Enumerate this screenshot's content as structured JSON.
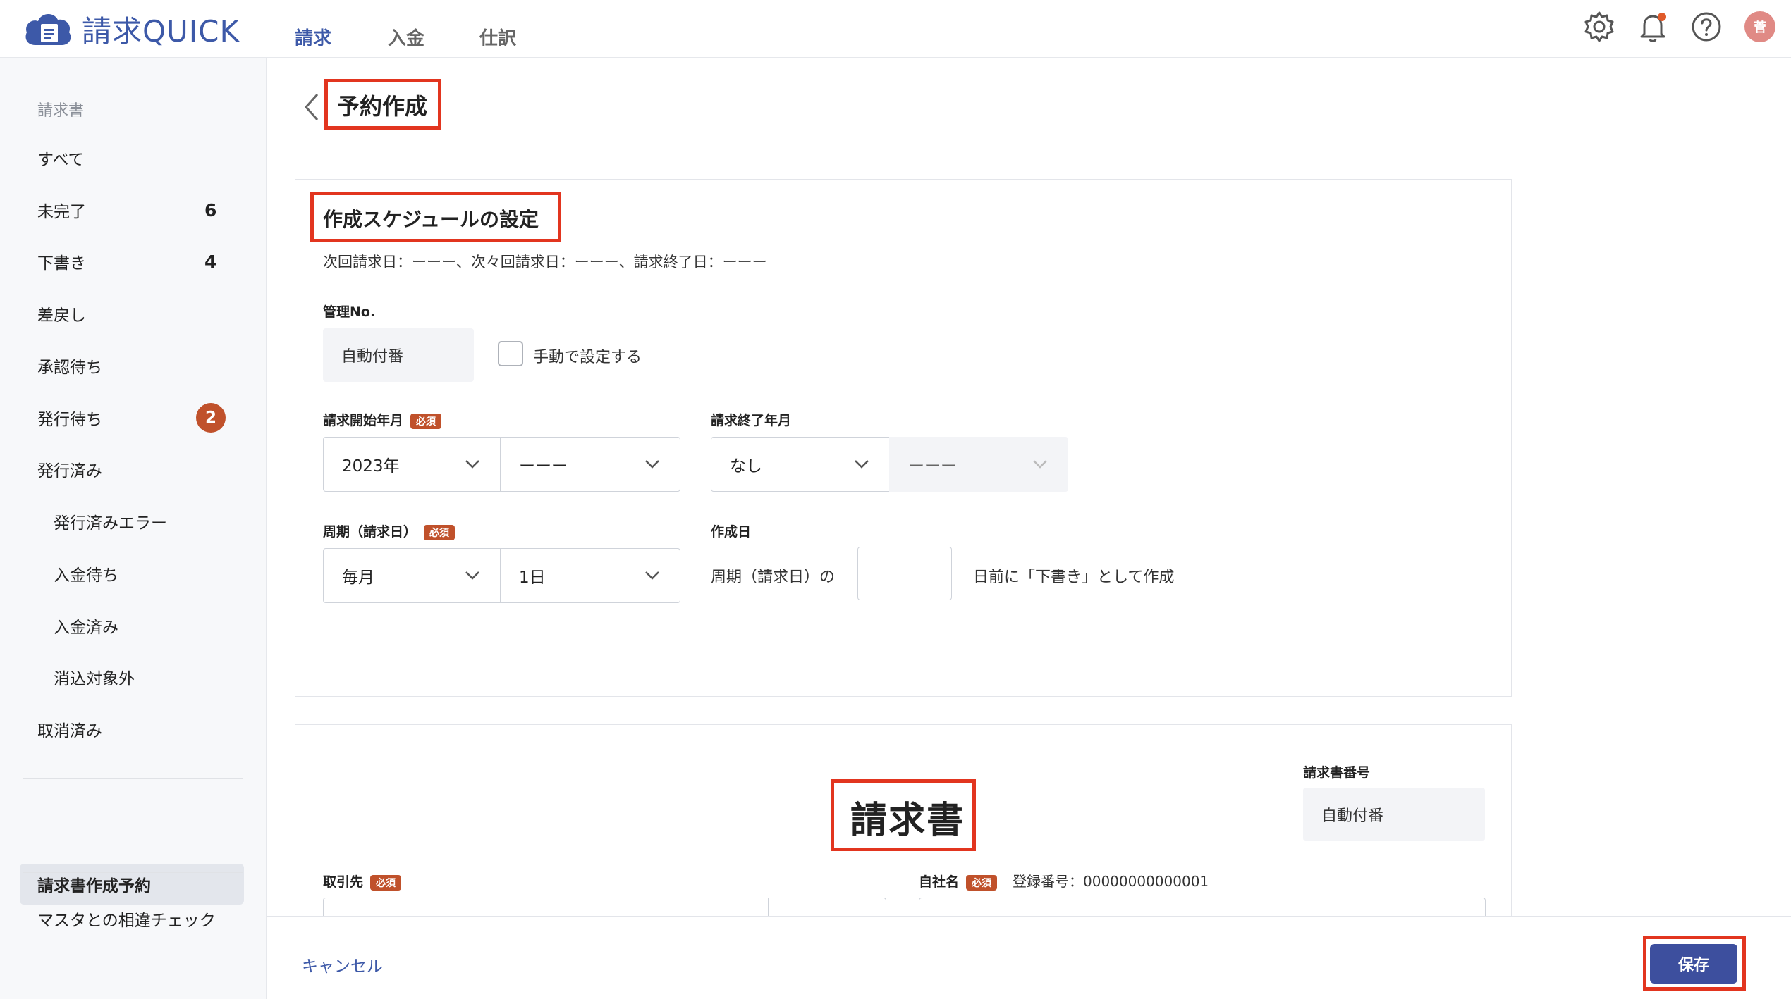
{
  "app": {
    "name": "請求QUICK",
    "brand_color": "#3d59a8"
  },
  "nav": {
    "items": [
      {
        "label": "請求",
        "active": true
      },
      {
        "label": "入金",
        "active": false
      },
      {
        "label": "仕訳",
        "active": false
      }
    ]
  },
  "header": {
    "avatar_initial": "菅"
  },
  "sidebar": {
    "section_label": "請求書",
    "items": [
      {
        "label": "すべて"
      },
      {
        "label": "未完了",
        "count": "6"
      },
      {
        "label": "下書き",
        "count": "4"
      },
      {
        "label": "差戻し"
      },
      {
        "label": "承認待ち"
      },
      {
        "label": "発行待ち",
        "badge": "2"
      },
      {
        "label": "発行済み"
      },
      {
        "label": "発行済みエラー"
      },
      {
        "label": "入金待ち"
      },
      {
        "label": "入金済み"
      },
      {
        "label": "消込対象外"
      },
      {
        "label": "取消済み"
      }
    ],
    "active_item": "請求書作成予約",
    "bottom_item": "マスタとの相違チェック"
  },
  "page": {
    "title": "予約作成"
  },
  "schedule": {
    "title": "作成スケジュールの設定",
    "next_dates": "次回請求日：ーーー、次々回請求日：ーーー、請求終了日：ーーー",
    "mgmt_label": "管理No.",
    "mgmt_value": "自動付番",
    "manual_label": "手動で設定する",
    "start_label": "請求開始年月",
    "required": "必須",
    "start_year": "2023年",
    "start_month": "ーーー",
    "end_label": "請求終了年月",
    "end_year": "なし",
    "end_month": "ーーー",
    "cycle_label": "周期（請求日）",
    "cycle_freq": "毎月",
    "cycle_day": "1日",
    "create_label": "作成日",
    "create_prefix": "周期（請求日）の",
    "create_suffix": "日前に「下書き」として作成"
  },
  "invoice": {
    "title": "請求書",
    "number_label": "請求書番号",
    "number_value": "自動付番",
    "client_label": "取引先",
    "company_label": "自社名",
    "reg_no": "登録番号：00000000000001"
  },
  "footer": {
    "cancel": "キャンセル",
    "save": "保存"
  }
}
